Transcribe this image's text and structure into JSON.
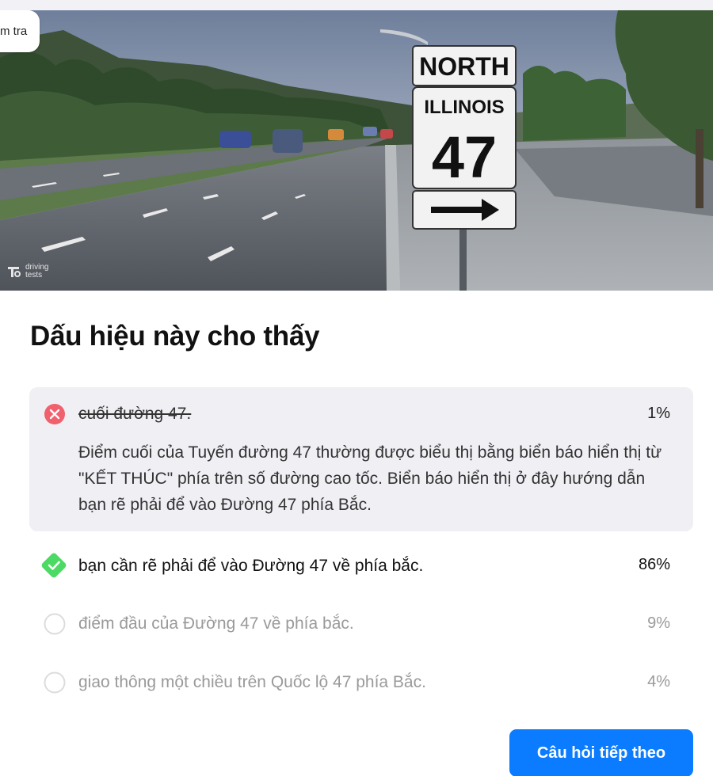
{
  "badge": {
    "label": "m tra"
  },
  "hero": {
    "sign_top": "NORTH",
    "sign_state": "ILLINOIS",
    "sign_number": "47",
    "arrow_icon": "right-arrow-icon",
    "watermark_line1": "driving",
    "watermark_line2": "tests"
  },
  "question": {
    "title": "Dấu hiệu này cho thấy"
  },
  "answers": [
    {
      "text": "cuối đường 47.",
      "percent": "1%",
      "status": "wrong",
      "icon": "x-circle-icon",
      "explanation": "Điểm cuối của Tuyến đường 47 thường được biểu thị bằng biển báo hiển thị từ \"KẾT THÚC\" phía trên số đường cao tốc. Biển báo hiển thị ở đây hướng dẫn bạn rẽ phải để vào Đường 47 phía Bắc."
    },
    {
      "text": "bạn cần rẽ phải để vào Đường 47 về phía bắc.",
      "percent": "86%",
      "status": "correct",
      "icon": "check-diamond-icon"
    },
    {
      "text": "điểm đầu của Đường 47 về phía bắc.",
      "percent": "9%",
      "status": "unselected",
      "icon": "empty-circle-icon"
    },
    {
      "text": "giao thông một chiều trên Quốc lộ 47 phía Bắc.",
      "percent": "4%",
      "status": "unselected",
      "icon": "empty-circle-icon"
    }
  ],
  "actions": {
    "next_label": "Câu hỏi tiếp theo"
  },
  "colors": {
    "accent": "#0b7cff",
    "wrong": "#f0606d",
    "correct": "#4cd964",
    "panel": "#f0eff4"
  }
}
